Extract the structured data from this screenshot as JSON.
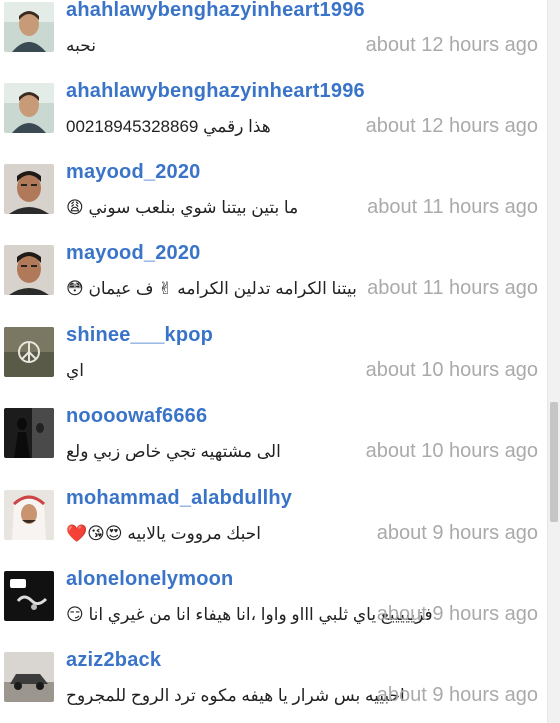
{
  "comments": [
    {
      "username": "ahahlawybenghazyinheart1996",
      "message": "نحبه",
      "time": "about 12 hours ago",
      "avatar_icon": "man-portrait"
    },
    {
      "username": "ahahlawybenghazyinheart1996",
      "message": "هذا رقمي 00218945328869",
      "time": "about 12 hours ago",
      "avatar_icon": "man-portrait"
    },
    {
      "username": "mayood_2020",
      "message": "ما بتين بيتنا شوي بنلعب سوني 😩",
      "time": "about 11 hours ago",
      "avatar_icon": "young-man-portrait"
    },
    {
      "username": "mayood_2020",
      "message": "بيتنا الكرامه تدلين الكرامه ✌ ف عيمان 😳",
      "time": "about 11 hours ago",
      "avatar_icon": "young-man-portrait"
    },
    {
      "username": "shinee___kpop",
      "message": "اي",
      "time": "about 10 hours ago",
      "avatar_icon": "peace-sign-image"
    },
    {
      "username": "noooowaf6666",
      "message": "الى مشتهيه تجي خاص زبي ولع",
      "time": "about 10 hours ago",
      "avatar_icon": "dark-silhouette"
    },
    {
      "username": "mohammad_alabdullhy",
      "message": "احبك مرووت يالابيه 😍😘❤️",
      "time": "about 9 hours ago",
      "avatar_icon": "man-headdress"
    },
    {
      "username": "alonelonelymoon",
      "message": "فزيييييع ياي ثلبي اااو واوا ،انا هيفاء انا من غيري انا 😏",
      "time": "about 9 hours ago",
      "avatar_icon": "vip-badge-image"
    },
    {
      "username": "aziz2back",
      "message": "احبييه بس شرار يا هيفه مكوه ترد الروح للمجروح",
      "time": "about 9 hours ago",
      "avatar_icon": "car-image"
    }
  ]
}
